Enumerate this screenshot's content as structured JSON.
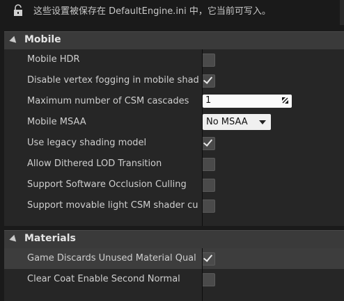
{
  "notice": {
    "icon": "lock-icon",
    "text": "这些设置被保存在 DefaultEngine.ini 中，它当前可写入。"
  },
  "mobile": {
    "title": "Mobile",
    "rows": [
      {
        "label": "Mobile HDR",
        "control": "checkbox",
        "checked": false
      },
      {
        "label": "Disable vertex fogging in mobile shad",
        "control": "checkbox",
        "checked": true
      },
      {
        "label": "Maximum number of CSM cascades",
        "control": "number",
        "value": "1"
      },
      {
        "label": "Mobile MSAA",
        "control": "combo",
        "value": "No MSAA"
      },
      {
        "label": "Use legacy shading model",
        "control": "checkbox",
        "checked": true
      },
      {
        "label": "Allow Dithered LOD Transition",
        "control": "checkbox",
        "checked": false
      },
      {
        "label": "Support Software Occlusion Culling",
        "control": "checkbox",
        "checked": false
      },
      {
        "label": "Support movable light CSM shader cu",
        "control": "checkbox",
        "checked": false
      }
    ]
  },
  "materials": {
    "title": "Materials",
    "rows": [
      {
        "label": "Game Discards Unused Material Qual",
        "control": "checkbox",
        "checked": true
      },
      {
        "label": "Clear Coat Enable Second Normal",
        "control": "checkbox",
        "checked": false
      }
    ]
  }
}
